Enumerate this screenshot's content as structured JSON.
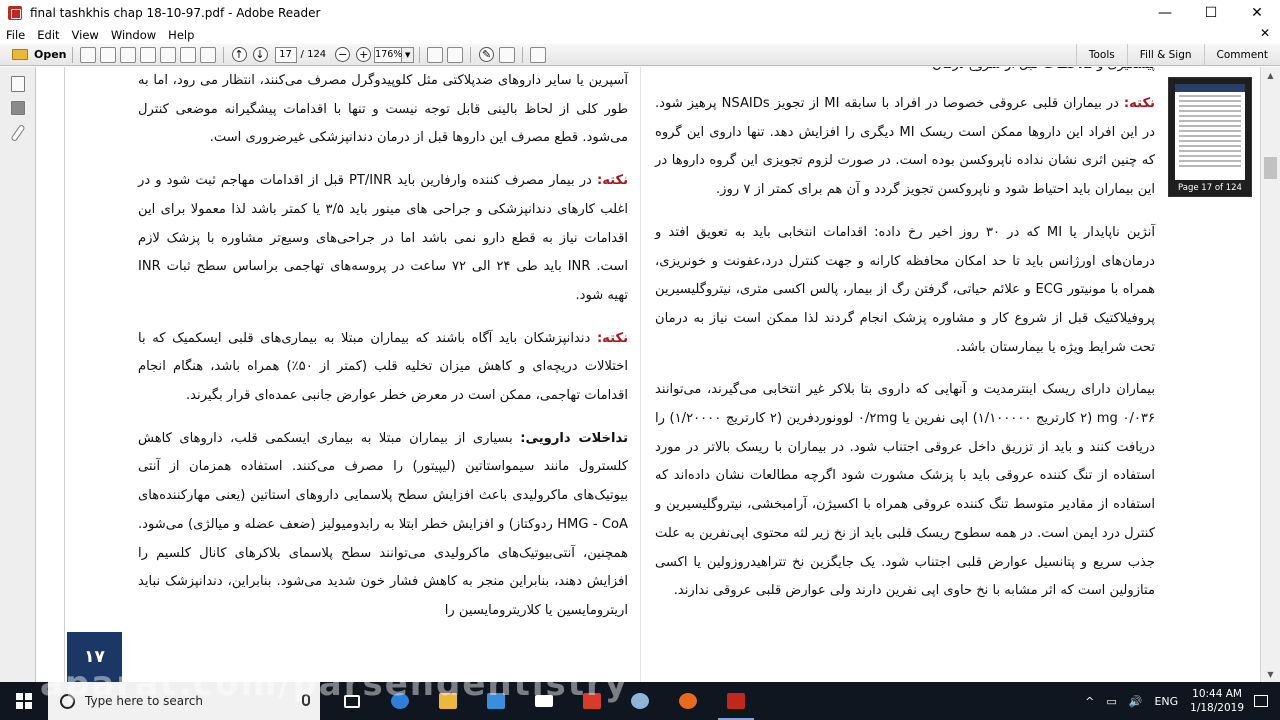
{
  "window": {
    "title": "final tashkhis chap 18-10-97.pdf - Adobe Reader",
    "minimize": "—",
    "maximize": "☐",
    "close": "✕"
  },
  "menu": {
    "items": [
      "File",
      "Edit",
      "View",
      "Window",
      "Help"
    ],
    "close_doc": "✕"
  },
  "toolbar": {
    "open_label": "Open",
    "page_current": "17",
    "page_total": "/ 124",
    "zoom": "176%",
    "tools_label": "Tools",
    "fill_sign_label": "Fill & Sign",
    "comment_label": "Comment"
  },
  "thumbnail": {
    "label": "Page 17 of 124"
  },
  "document": {
    "right_column": {
      "cut_line": "پیشگیری و ملاحظات قبل از شروع درمان",
      "p1_note": "نکته:",
      "p1_text": " در بیماران قلبی عروقی خصوصا در افراد با سابقه MI از تجویز NSAIDs پرهیز شود. در این افراد این داروها ممکن است ریسک MI دیگری را افزایش دهد. تنها داروی این گروه که چنین اثری نشان نداده ناپروکسن بوده است. در صورت لزوم تجویزی این گروه داروها در این بیماران باید احتیاط شود و ناپروکسن تجویز گردد و آن هم برای کمتر از ۷ روز.",
      "p2_text": "آنژین ناپایدار یا MI که در ۳۰ روز اخیر رخ داده: اقدامات انتخابی باید به تعویق افتد و درمان‌های اورژانس باید تا حد امکان محافظه کارانه و جهت کنترل درد،عفونت و خونریزی، همراه با مونیتور ECG و علائم حیاتی، گرفتن رگ از بیمار، پالس اکسی متری، نیتروگلیسیرین پروفیلاکتیک قبل از شروع کار و مشاوره پزشک انجام گردند لذا ممکن است نیاز به درمان تحت شرایط ویژه یا بیمارستان باشد.",
      "p3_text": "بیماران دارای ریسک اینترمدیت و آنهایی که داروی بتا بلاکر غیر انتخابی می‌گیرند، می‌توانند ۰/۰۳۶ mg (۲ کارتریج ۱/۱۰۰۰۰۰) اپی نفرین یا ۰/۲mg لوونوردفرین (۲ کارتریج ۱/۲۰۰۰۰) را دریافت کنند و باید از تزریق داخل عروقی اجتناب شود. در بیماران با ریسک بالاتر در مورد استفاده از تنگ کننده عروقی باید با پزشک مشورت شود اگرچه مطالعات نشان داده‌اند که استفاده از مقادیر متوسط تنگ کننده عروقی همراه با اکسیژن، آرامبخشی، نیتروگلیسیرین و کنترل درد ایمن است. در همه سطوح ریسک قلبی باید از نخ زیر لثه محتوی اپی‌نفرین به علت جذب سریع و پتانسیل عوارض قلبی اجتناب شود. یک جایگزین نخ تتراهیدروزولین یا اکسی متازولین است که اثر مشابه با نخ حاوی اپی نفرین دارند ولی عوارض قلبی عروقی ندارند."
    },
    "left_column": {
      "p1_text": "آسپرین یا سایر داروهای ضدپلاکتی مثل کلوپیدوگرل مصرف می‌کنند، انتظار می رود، اما به طور کلی از لحاظ بالینی قابل توجه نیست و تنها با اقدامات پیشگیرانه موضعی کنترل می‌شود. قطع مصرف این داروها قبل از درمان دندانپزشکی غیرضروری است.",
      "p2_note": "نکته:",
      "p2_text": " در بیمار مصرف کننده وارفارین باید PT/INR قبل از اقدامات مهاجم ثبت شود و در اغلب کارهای دندانپزشکی و جراحی های مینور باید ۳/۵ یا کمتر باشد لذا معمولا برای این اقدامات نیاز به قطع دارو نمی باشد اما در جراحی‌های وسیع‌تر مشاوره با پزشک لازم است. INR باید طی ۲۴ الی ۷۲ ساعت در پروسه‌های تهاجمی براساس سطح ثبات INR تهیه شود.",
      "p3_note": "نکته:",
      "p3_text": " دندانپزشکان باید آگاه باشند که بیماران مبتلا به بیماری‌های قلبی ایسکمیک که با اختلالات دریچه‌ای و کاهش میزان تخلیه قلب (کمتر از ۵۰٪) همراه باشد، هنگام انجام اقدامات تهاجمی، ممکن است در معرض خطر عوارض جانبی عمده‌ای قرار بگیرند.",
      "p4_bold": "تداخلات دارویی:",
      "p4_text": " بسیاری از بیماران مبتلا به بیماری ایسکمی قلب، داروهای کاهش کلسترول مانند سیمواستاتین (لیپیتور) را مصرف می‌کنند. استفاده همزمان از آنتی بیوتیک‌های ماکرولیدی باعث افزایش سطح پلاسمایی داروهای استاتین (یعنی مهارکننده‌های HMG - CoA ردوکتاز) و افزایش خطر ابتلا به رابدومیولیز (ضعف عضله و میالژی) می‌شود. همچنین، آنتی‌بیوتیک‌های ماکرولیدی می‌توانند سطح پلاسمای بلاکرهای کانال کلسیم را افزایش دهند، بنابراین منجر به کاهش فشار خون شدید می‌شود. بنابراین، دندانپزشک نباید اریترومایسین یا کلاریترومایسین را"
    },
    "page_number": "۱۷"
  },
  "taskbar": {
    "search_placeholder": "Type here to search",
    "lang": "ENG",
    "time": "10:44 AM",
    "date": "1/18/2019",
    "tray_up": "^",
    "volume": "🔊",
    "network": "▭"
  },
  "watermark": "aparat.com/parsendentistry",
  "colors": {
    "note_red": "#a21a1a",
    "page_box_navy": "#1a3766",
    "taskbar_bg": "#0f1620"
  }
}
